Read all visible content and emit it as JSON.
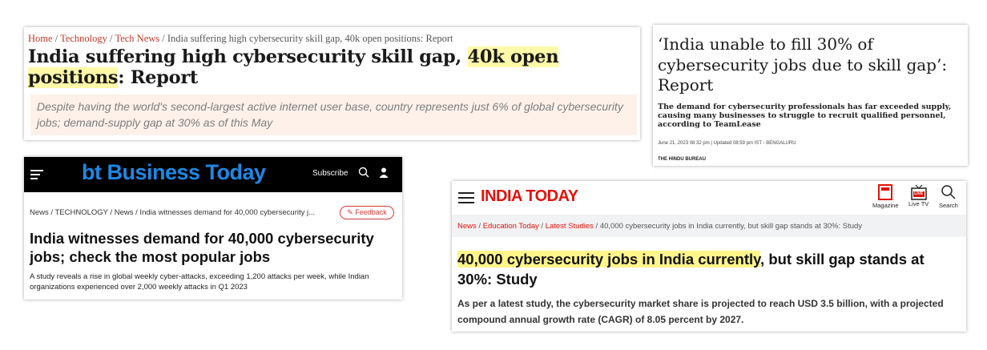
{
  "card1": {
    "breadcrumb": {
      "home": "Home",
      "technology": "Technology",
      "tech_news": "Tech News",
      "current": "India suffering high cybersecurity skill gap, 40k open positions: Report",
      "separator": "/"
    },
    "title_part1": "India suffering high cybersecurity skill gap, ",
    "title_highlight": "40k open positions",
    "title_part2": ": Report",
    "subtitle": "Despite having the world's second-largest active internet user base, country represents just 6% of global cybersecurity jobs; demand-supply gap at 30% as of this May"
  },
  "card2": {
    "title": "‘India unable to fill 30% of cybersecurity jobs due to skill gap’: Report",
    "summary": "The demand for cybersecurity professionals has far exceeded supply, causing many businesses to struggle to recruit qualified personnel, according to TeamLease",
    "meta": "June 21, 2023 08:32 pm | Updated 08:59 pm IST - BENGALURU",
    "source": "THE HINDU BUREAU"
  },
  "card3": {
    "logo_bt": "bt",
    "logo_name": "Business Today",
    "subscribe_label": "Subscribe",
    "breadcrumb": "News / TECHNOLOGY / News / India witnesses demand for 40,000 cybersecurity j...",
    "feedback_label": "Feedback",
    "title": "India witnesses demand for 40,000 cybersecurity jobs; check the most popular jobs",
    "subtitle": "A study reveals a rise in global weekly cyber-attacks, exceeding 1,200 attacks per week, while Indian organizations experienced over 2,000 weekly attacks in Q1 2023",
    "colors": {
      "logo": "#1e88e5",
      "topbar": "#000000",
      "feedback": "#d43a3a"
    }
  },
  "card4": {
    "logo": "INDIA TODAY",
    "tools": {
      "magazine": "Magazine",
      "live_tv": "Live TV",
      "search": "Search",
      "live_badge": "LIVE"
    },
    "breadcrumb": {
      "news": "News",
      "education_today": "Education Today",
      "latest_studies": "Latest Studies",
      "current": "40,000 cybersecurity jobs in India currently, but skill gap stands at 30%: Study",
      "separator": "/"
    },
    "title_highlight": "40,000 cybersecurity jobs in India currently",
    "title_rest": ", but skill gap stands at 30%: Study",
    "subtitle": "As per a latest study, the cybersecurity market share is projected to reach USD 3.5 billion, with a projected compound annual growth rate (CAGR) of 8.05 percent by 2027.",
    "colors": {
      "logo": "#e3120b",
      "highlight": "#fff58a"
    }
  }
}
